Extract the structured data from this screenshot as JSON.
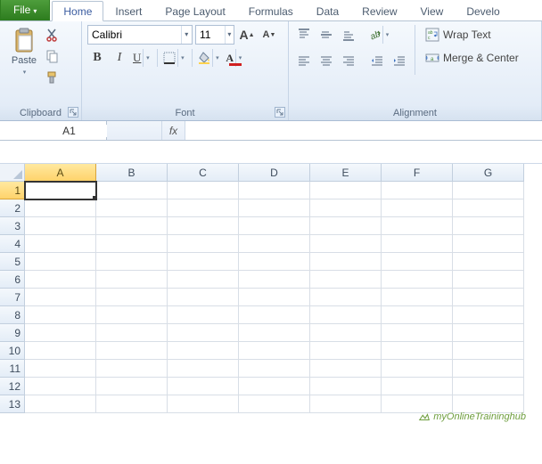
{
  "tabs": {
    "file": "File",
    "items": [
      "Home",
      "Insert",
      "Page Layout",
      "Formulas",
      "Data",
      "Review",
      "View",
      "Develo"
    ],
    "active": 0
  },
  "clipboard": {
    "label": "Clipboard",
    "paste": "Paste"
  },
  "font": {
    "label": "Font",
    "name": "Calibri",
    "size": "11",
    "incA": "A",
    "decA": "A",
    "bold": "B",
    "italic": "I",
    "underline": "U"
  },
  "alignment": {
    "label": "Alignment",
    "wrap": "Wrap Text",
    "merge": "Merge & Center"
  },
  "bar": {
    "cellRef": "A1",
    "fx": "fx",
    "formula": ""
  },
  "grid": {
    "cols": [
      "A",
      "B",
      "C",
      "D",
      "E",
      "F",
      "G"
    ],
    "rows": [
      "1",
      "2",
      "3",
      "4",
      "5",
      "6",
      "7",
      "8",
      "9",
      "10",
      "11",
      "12",
      "13"
    ],
    "selected": {
      "col": "A",
      "row": "1"
    }
  },
  "watermark": "myOnlineTraininghub"
}
